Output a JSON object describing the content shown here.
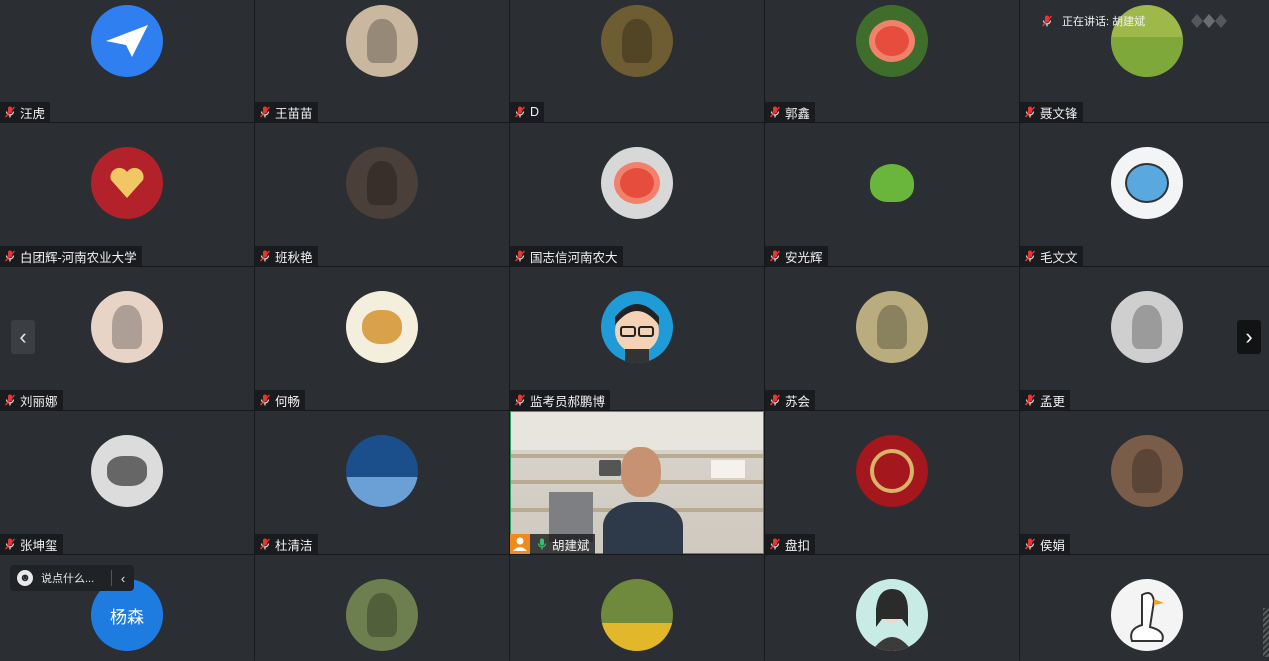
{
  "participants": [
    {
      "name": "汪虎",
      "avatar": "bird-logo-avatar",
      "color": "#2f7ff0"
    },
    {
      "name": "王苗苗",
      "avatar": "photo-avatar",
      "color": "#c9b7a0"
    },
    {
      "name": "D",
      "avatar": "photo-avatar",
      "color": "#6e5c33"
    },
    {
      "name": "郭鑫",
      "avatar": "flower-avatar",
      "color": "#3f6e2c"
    },
    {
      "name": "聂文锋",
      "avatar": "grass-avatar",
      "color": "#9fb84a"
    },
    {
      "name": "白团辉-河南农业大学",
      "avatar": "apple-heart-avatar",
      "color": "#b3222a"
    },
    {
      "name": "班秋艳",
      "avatar": "photo-avatar",
      "color": "#4b3f3a"
    },
    {
      "name": "国志信河南农大",
      "avatar": "flower-avatar",
      "color": "#d8d8d8"
    },
    {
      "name": "安光辉",
      "avatar": "lettuce-avatar",
      "color": "#2b2e32"
    },
    {
      "name": "毛文文",
      "avatar": "cartoon-avatar",
      "color": "#f2f4f5"
    },
    {
      "name": "刘丽娜",
      "avatar": "photo-avatar",
      "color": "#e7d4c7"
    },
    {
      "name": "何畅",
      "avatar": "cat-drawing-avatar",
      "color": "#f4eedc"
    },
    {
      "name": "监考员郝鹏博",
      "avatar": "cartoon-boy-avatar",
      "color": "#1f9bd7"
    },
    {
      "name": "苏会",
      "avatar": "photo-avatar",
      "color": "#b9ad7f"
    },
    {
      "name": "孟更",
      "avatar": "photo-avatar",
      "color": "#cfcfcf"
    },
    {
      "name": "张坤玺",
      "avatar": "horse-painting-avatar",
      "color": "#dcdcdc"
    },
    {
      "name": "杜清洁",
      "avatar": "lake-avatar",
      "color": "#1b4f8c"
    },
    {
      "name": "胡建斌",
      "avatar": "live-video",
      "color": "#d0cbc2"
    },
    {
      "name": "盘扣",
      "avatar": "red-ornament-avatar",
      "color": "#a3171d"
    },
    {
      "name": "侯娟",
      "avatar": "photo-avatar",
      "color": "#7a5d49"
    },
    {
      "name": "",
      "avatar": "text-avatar",
      "initials": "杨森",
      "color": "#1e7be0"
    },
    {
      "name": "",
      "avatar": "photo-avatar",
      "color": "#6d7f4f"
    },
    {
      "name": "",
      "avatar": "sunflower-avatar",
      "color": "#6f8a3c"
    },
    {
      "name": "",
      "avatar": "woman-icon-avatar",
      "color": "#c9ebe6"
    },
    {
      "name": "",
      "avatar": "goose-cartoon-avatar",
      "color": "#f4f4f4"
    }
  ],
  "speaker": {
    "label": "正在讲话: 胡建斌"
  },
  "chat": {
    "placeholder": "说点什么..."
  },
  "nav": {
    "prev": "‹",
    "next": "›"
  }
}
